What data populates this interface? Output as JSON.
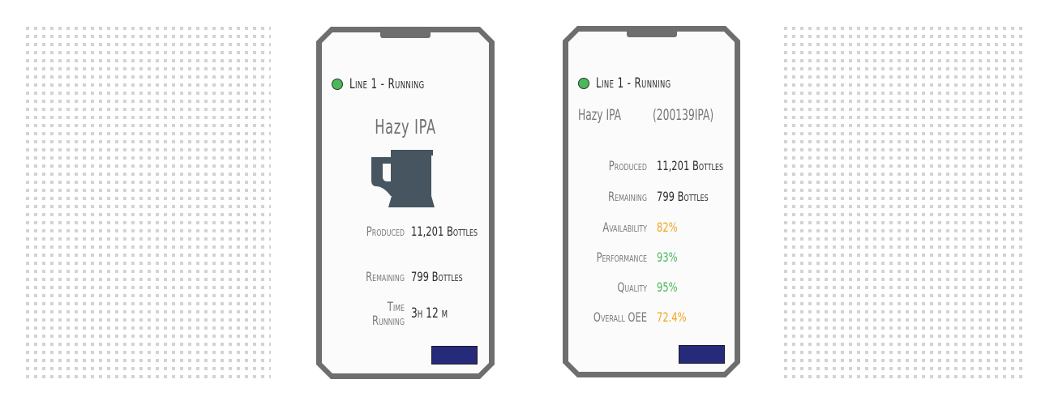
{
  "colors": {
    "status_running": "#4cb85a",
    "warning": "#f5a523",
    "good": "#4cb85a",
    "button": "#252a7a",
    "frame": "#6e6e6e"
  },
  "phone_simple": {
    "status": {
      "icon": "status-dot-icon",
      "label": "Line 1 - Running"
    },
    "product_title": "Hazy IPA",
    "product_icon": "beer-mug-icon",
    "produced": {
      "label": "Produced",
      "value": "11,201 Bottles"
    },
    "remaining": {
      "label": "Remaining",
      "value": "799 Bottles"
    },
    "time_running": {
      "label_line1": "Time",
      "label_line2": "Running",
      "value": "3h 12 m"
    },
    "button_label": ""
  },
  "phone_detail": {
    "status": {
      "icon": "status-dot-icon",
      "label": "Line 1 - Running"
    },
    "product_name": "Hazy IPA",
    "product_code": "(200139IPA)",
    "metrics": [
      {
        "label": "Produced",
        "value": "11,201 Bottles",
        "tone": "neutral"
      },
      {
        "label": "Remaining",
        "value": "799 Bottles",
        "tone": "neutral"
      },
      {
        "label": "Availability",
        "value": "82%",
        "tone": "warn"
      },
      {
        "label": "Performance",
        "value": "93%",
        "tone": "good"
      },
      {
        "label": "Quality",
        "value": "95%",
        "tone": "good"
      },
      {
        "label": "Overall OEE",
        "value": "72.4%",
        "tone": "warn"
      }
    ],
    "button_label": ""
  }
}
